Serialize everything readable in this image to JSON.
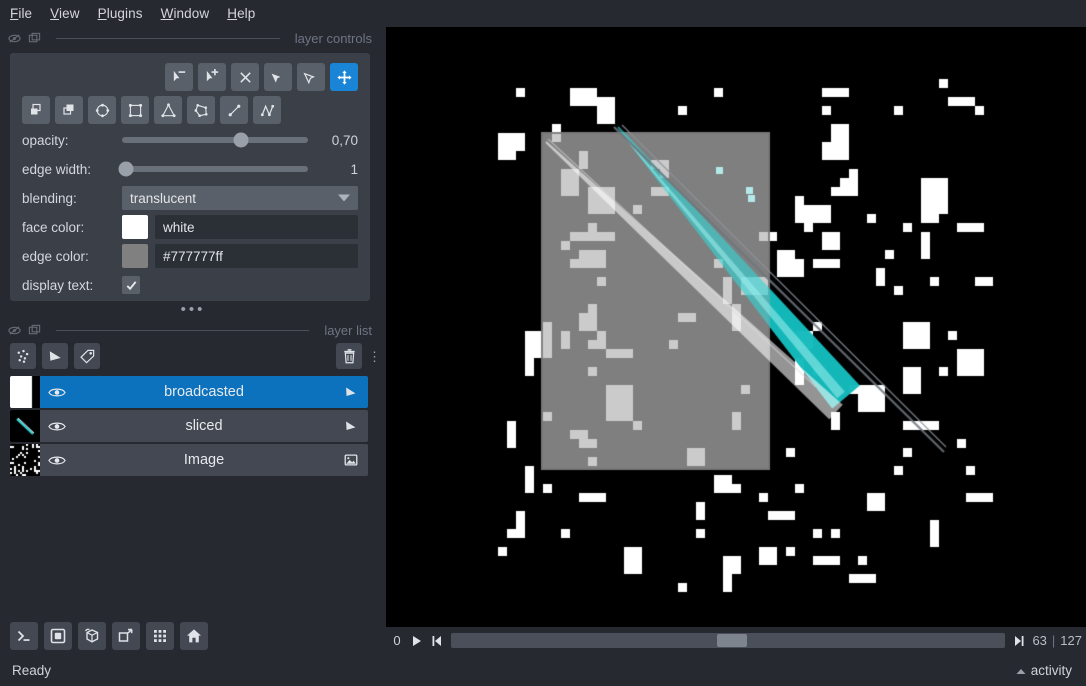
{
  "menu": {
    "items": [
      {
        "label": "File",
        "mnemonic": "F"
      },
      {
        "label": "View",
        "mnemonic": "V"
      },
      {
        "label": "Plugins",
        "mnemonic": "P"
      },
      {
        "label": "Window",
        "mnemonic": "W"
      },
      {
        "label": "Help",
        "mnemonic": "H"
      }
    ]
  },
  "layer_controls": {
    "title": "layer controls",
    "tools_row1": [
      {
        "name": "select-vertex-remove-tool",
        "icon": "vertex-remove-icon",
        "active": false
      },
      {
        "name": "select-vertex-insert-tool",
        "icon": "vertex-insert-icon",
        "active": false
      },
      {
        "name": "delete-shape-tool",
        "icon": "x-icon",
        "active": false
      },
      {
        "name": "select-shapes-tool",
        "icon": "cursor-filled-icon",
        "active": false
      },
      {
        "name": "direct-select-tool",
        "icon": "cursor-outline-icon",
        "active": false
      },
      {
        "name": "pan-zoom-tool",
        "icon": "move-icon",
        "active": true
      }
    ],
    "tools_row2": [
      {
        "name": "move-back-tool",
        "icon": "move-back-icon",
        "active": false
      },
      {
        "name": "move-front-tool",
        "icon": "move-front-icon",
        "active": false
      },
      {
        "name": "add-ellipse-tool",
        "icon": "ellipse-icon",
        "active": false
      },
      {
        "name": "add-rectangle-tool",
        "icon": "rectangle-icon",
        "active": false
      },
      {
        "name": "add-polygon-tool",
        "icon": "triangle-icon",
        "active": false
      },
      {
        "name": "add-polygon-lasso-tool",
        "icon": "polygon-icon",
        "active": false
      },
      {
        "name": "add-line-tool",
        "icon": "line-icon",
        "active": false
      },
      {
        "name": "add-path-tool",
        "icon": "path-icon",
        "active": false
      }
    ],
    "opacity": {
      "label": "opacity:",
      "value": "0,70",
      "percent": 64
    },
    "edge_width": {
      "label": "edge width:",
      "value": "1",
      "percent": 2
    },
    "blending": {
      "label": "blending:",
      "value": "translucent"
    },
    "face_color": {
      "label": "face color:",
      "value": "white",
      "swatch": "#ffffff"
    },
    "edge_color": {
      "label": "edge color:",
      "value": "#777777ff",
      "swatch": "#808080"
    },
    "display_text": {
      "label": "display text:",
      "checked": true
    }
  },
  "layer_list": {
    "title": "layer list",
    "actions": [
      {
        "name": "new-points-layer-button",
        "icon": "points-icon"
      },
      {
        "name": "new-shapes-layer-button",
        "icon": "shapes-icon"
      },
      {
        "name": "new-labels-layer-button",
        "icon": "labels-icon"
      }
    ],
    "delete_label": "delete-layer-button",
    "layers": [
      {
        "name": "broadcasted",
        "type": "shapes",
        "visible": true,
        "selected": true,
        "thumb": "shape-thumb"
      },
      {
        "name": "sliced",
        "type": "shapes",
        "visible": true,
        "selected": false,
        "thumb": "sliced-thumb"
      },
      {
        "name": "Image",
        "type": "image",
        "visible": true,
        "selected": false,
        "thumb": "noise-thumb"
      }
    ]
  },
  "viewer_buttons": [
    {
      "name": "console-button",
      "icon": "terminal-icon"
    },
    {
      "name": "ndisplay-button",
      "icon": "square-icon"
    },
    {
      "name": "roll-dims-button",
      "icon": "cube-icon"
    },
    {
      "name": "transpose-dims-button",
      "icon": "transpose-icon"
    },
    {
      "name": "grid-view-button",
      "icon": "grid-icon"
    },
    {
      "name": "reset-view-button",
      "icon": "home-icon"
    }
  ],
  "dims": {
    "axis_label": "0",
    "play_label": "play-button",
    "current": "63",
    "separator": "|",
    "max": "127",
    "handle_percent": 48
  },
  "statusbar": {
    "status": "Ready",
    "activity": "activity"
  },
  "colors": {
    "accent": "#1a85d6",
    "selected_row": "#0d72bd",
    "panel": "#3b4048",
    "background": "#262930",
    "shape_cyan": "#35d5d5",
    "shape_white": "#ffffff",
    "rect_fill": "#b5b5b5",
    "rect_edge": "#777777"
  }
}
